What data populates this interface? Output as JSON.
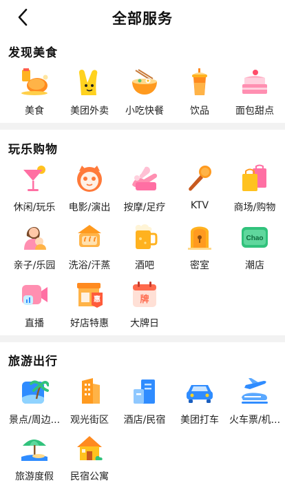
{
  "header": {
    "title": "全部服务"
  },
  "sections": [
    {
      "title": "发现美食",
      "items": [
        {
          "label": "美食",
          "icon": "food-icon"
        },
        {
          "label": "美团外卖",
          "icon": "delivery-icon"
        },
        {
          "label": "小吃快餐",
          "icon": "noodle-bowl-icon"
        },
        {
          "label": "饮品",
          "icon": "drink-icon"
        },
        {
          "label": "面包甜点",
          "icon": "cake-icon"
        }
      ]
    },
    {
      "title": "玩乐购物",
      "items": [
        {
          "label": "休闲/玩乐",
          "icon": "cocktail-icon"
        },
        {
          "label": "电影/演出",
          "icon": "movie-cat-icon"
        },
        {
          "label": "按摩/足疗",
          "icon": "massage-icon"
        },
        {
          "label": "KTV",
          "icon": "microphone-icon"
        },
        {
          "label": "商场/购物",
          "icon": "shopping-bag-icon"
        },
        {
          "label": "亲子/乐园",
          "icon": "parent-child-icon"
        },
        {
          "label": "洗浴/汗蒸",
          "icon": "bath-icon"
        },
        {
          "label": "酒吧",
          "icon": "beer-icon"
        },
        {
          "label": "密室",
          "icon": "escape-room-door-icon"
        },
        {
          "label": "潮店",
          "icon": "trendy-store-icon"
        },
        {
          "label": "直播",
          "icon": "live-video-icon"
        },
        {
          "label": "好店特惠",
          "icon": "store-deal-icon"
        },
        {
          "label": "大牌日",
          "icon": "calendar-brand-icon"
        }
      ]
    },
    {
      "title": "旅游出行",
      "items": [
        {
          "label": "景点/周边...",
          "icon": "scenic-icon"
        },
        {
          "label": "观光街区",
          "icon": "street-building-icon"
        },
        {
          "label": "酒店/民宿",
          "icon": "hotel-icon"
        },
        {
          "label": "美团打车",
          "icon": "taxi-icon"
        },
        {
          "label": "火车票/机...",
          "icon": "train-plane-icon"
        },
        {
          "label": "旅游度假",
          "icon": "beach-umbrella-icon"
        },
        {
          "label": "民宿公寓",
          "icon": "house-icon"
        }
      ]
    }
  ],
  "brand_text": {
    "trendy_store": "Chao",
    "store_deal": "惠",
    "calendar": "牌"
  },
  "colors": {
    "divider": "#f2f2f2",
    "orange": "#ff9a1f",
    "yellow": "#ffd21f",
    "pink": "#ff6fa3",
    "blue": "#2f8cff",
    "green": "#31c27c"
  }
}
